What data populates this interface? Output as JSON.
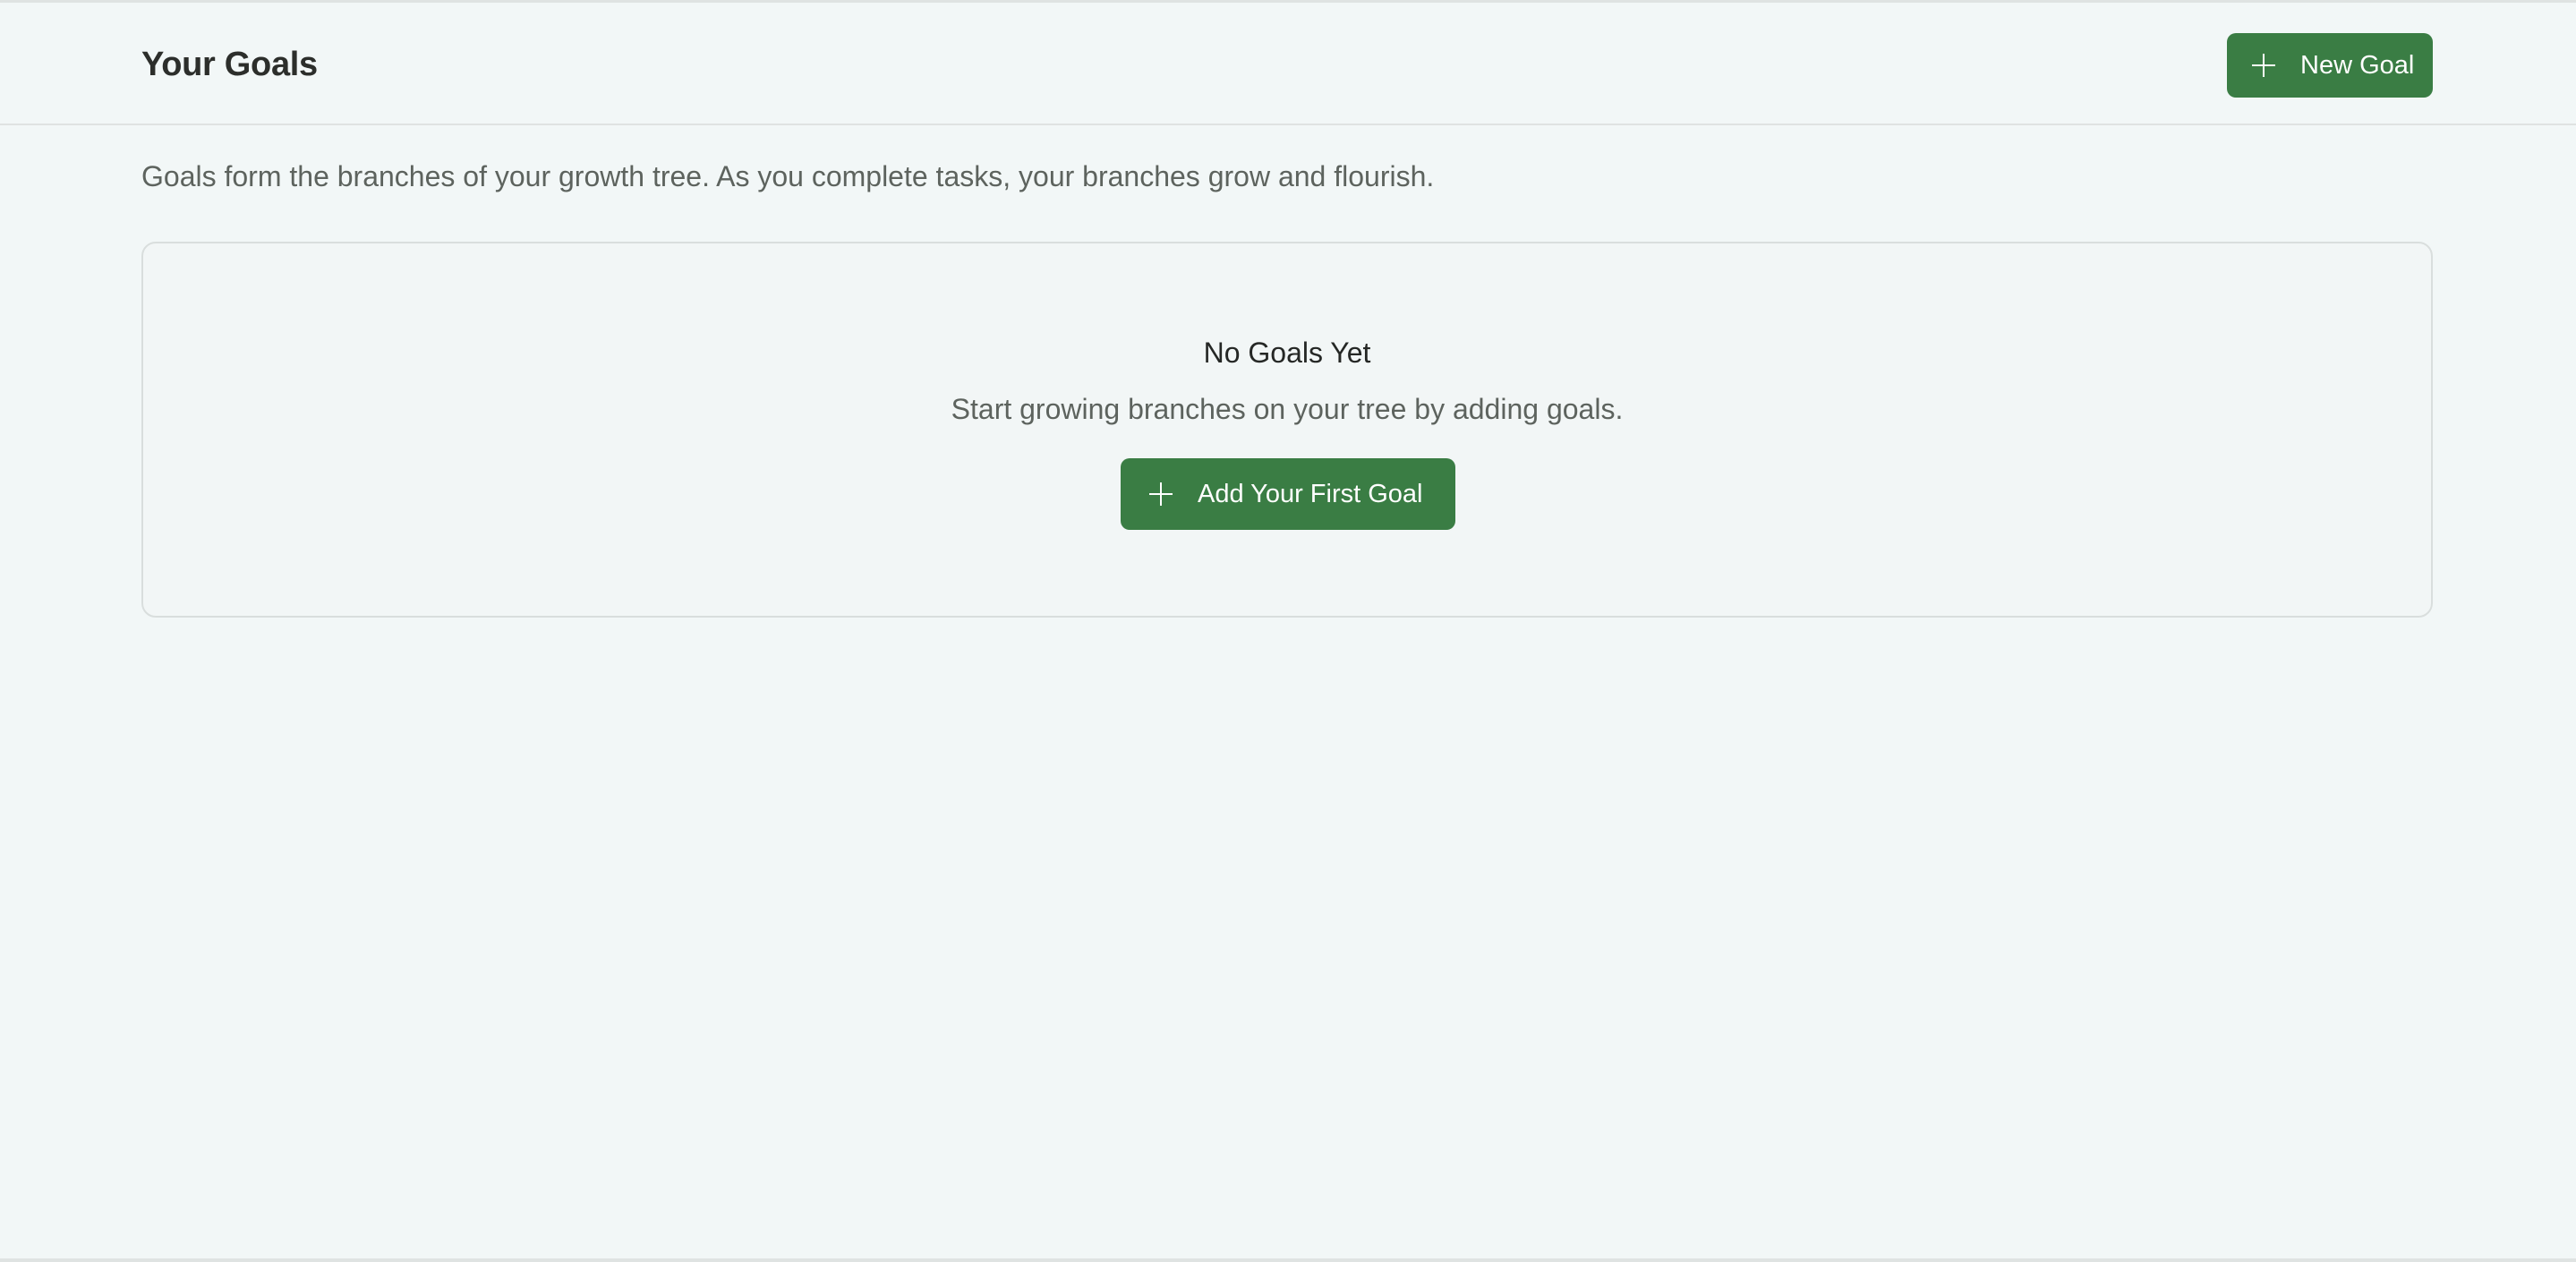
{
  "header": {
    "title": "Your Goals",
    "new_goal_label": "New Goal"
  },
  "intro": {
    "text": "Goals form the branches of your growth tree. As you complete tasks, your branches grow and flourish."
  },
  "empty_state": {
    "title": "No Goals Yet",
    "message": "Start growing branches on your tree by adding goals.",
    "cta_label": "Add Your First Goal"
  },
  "icons": {
    "new_goal": "plus-icon",
    "add_first_goal": "plus-icon"
  },
  "colors": {
    "background": "#f2f7f7",
    "accent": "#3a7d44",
    "border": "#dfe3e2",
    "text_primary": "#2c2e2b",
    "text_secondary": "#5d635e"
  }
}
